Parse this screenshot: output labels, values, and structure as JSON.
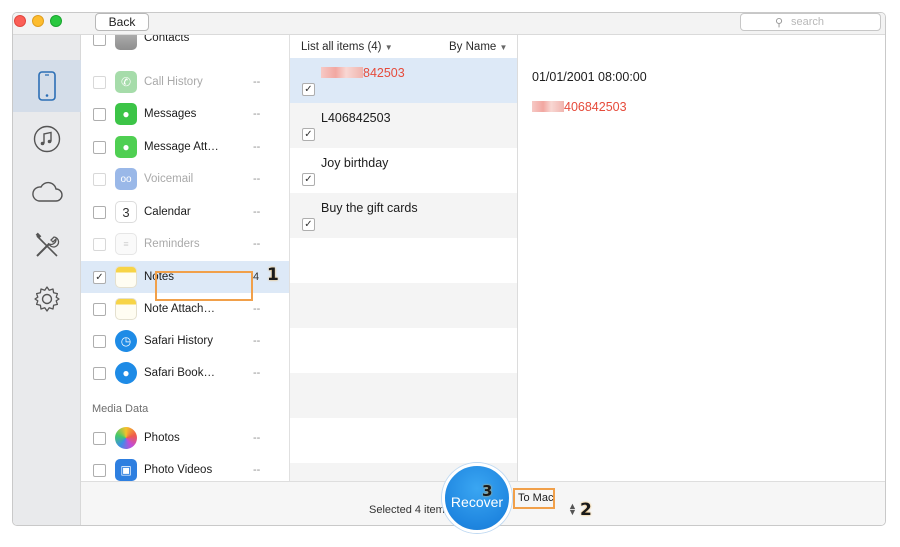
{
  "toolbar": {
    "back_label": "Back",
    "search_placeholder": "search"
  },
  "categories": [
    {
      "label": "Contacts",
      "count": "",
      "dim": false,
      "icon": "contacts-icon"
    },
    {
      "label": "Call History",
      "count": "--",
      "dim": true,
      "icon": "phone-icon"
    },
    {
      "label": "Messages",
      "count": "--",
      "dim": false,
      "icon": "messages-icon"
    },
    {
      "label": "Message Att…",
      "count": "--",
      "dim": false,
      "icon": "message-attachments-icon"
    },
    {
      "label": "Voicemail",
      "count": "--",
      "dim": true,
      "icon": "voicemail-icon"
    },
    {
      "label": "Calendar",
      "count": "--",
      "dim": false,
      "icon": "calendar-icon",
      "icon_text": "3"
    },
    {
      "label": "Reminders",
      "count": "--",
      "dim": true,
      "icon": "reminders-icon"
    },
    {
      "label": "Notes",
      "count": "4",
      "dim": false,
      "icon": "notes-icon",
      "checked": true
    },
    {
      "label": "Note Attach…",
      "count": "--",
      "dim": false,
      "icon": "note-attachments-icon"
    },
    {
      "label": "Safari History",
      "count": "--",
      "dim": false,
      "icon": "safari-history-icon"
    },
    {
      "label": "Safari Book…",
      "count": "--",
      "dim": false,
      "icon": "safari-bookmarks-icon"
    }
  ],
  "media_section": "Media Data",
  "media": [
    {
      "label": "Photos",
      "count": "--",
      "icon": "photos-icon"
    },
    {
      "label": "Photo Videos",
      "count": "--",
      "icon": "photo-videos-icon"
    }
  ],
  "list": {
    "filter_label": "List all items (4)",
    "sort_label": "By Name",
    "rows": [
      {
        "title": "842503",
        "red": true,
        "blurred": true
      },
      {
        "title": "L406842503",
        "red": false
      },
      {
        "title": "Joy birthday",
        "red": false
      },
      {
        "title": "Buy the gift cards",
        "red": false
      }
    ]
  },
  "detail": {
    "date": "01/01/2001 08:00:00",
    "title": "406842503"
  },
  "footer": {
    "selected": "Selected 4 items",
    "recover": "Recover",
    "destination": "To Mac"
  },
  "steps": {
    "one": "1",
    "two": "2",
    "three": "3"
  },
  "colors": {
    "accent": "#1f86e0",
    "highlight": "#f1a04a",
    "red_text": "#e64b3b",
    "selection": "#dde9f7"
  },
  "icons": {
    "rail": [
      "phone-device-icon",
      "music-icon",
      "cloud-icon",
      "tools-icon",
      "gear-icon"
    ]
  }
}
